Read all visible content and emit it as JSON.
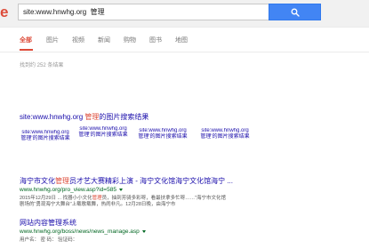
{
  "header": {
    "logo_fragment": "e",
    "query": "site:www.hnwhg.org  管理"
  },
  "tabs": [
    {
      "label": "全部",
      "active": true
    },
    {
      "label": "图片",
      "active": false
    },
    {
      "label": "视频",
      "active": false
    },
    {
      "label": "新闻",
      "active": false
    },
    {
      "label": "购物",
      "active": false
    },
    {
      "label": "图书",
      "active": false
    },
    {
      "label": "地图",
      "active": false
    }
  ],
  "result_stats": "找到约 252 条结果",
  "image_results": {
    "title_prefix": "site:www.hnwhg.org ",
    "title_keyword": "管理",
    "title_suffix": "的图片搜索结果",
    "thumbnails": [
      {
        "line1": "site:www.hnwhg.org",
        "line2": "管理'的图片搜索结果"
      },
      {
        "line1": "site:www.hnwhg.org",
        "line2": "管理'的图片搜索结果"
      },
      {
        "line1": "site:www.hnwhg.org",
        "line2": "管理'的图片搜索结果"
      },
      {
        "line1": "site:www.hnwhg.org",
        "line2": "管理'的图片搜索结果"
      }
    ]
  },
  "results": [
    {
      "title_prefix": "海宁市文化",
      "title_keyword": "管理",
      "title_suffix": "员才艺大赛精彩上演 - 海宁文化馆海宁文化馆海宁 ...",
      "url": "www.hnwhg.org/pro_view.asp?id=585",
      "snippet_line1": "2015年12月29日 ... 找器小小文化",
      "snippet_keyword": "管理",
      "snippet_line1_rest": "员，抽到芳骑多彩呀，看最扶拿多忙呀……”海宁市文化馆",
      "snippet_line2": "剧场的“勇现海宁大舞台”上载歌载舞，热闹非凡。12月28日晚，由海宁市"
    },
    {
      "title_prefix": "网站内容",
      "title_keyword": "管理",
      "title_suffix": "系统",
      "url": "www.hnwhg.org/boss/news/news_manage.asp",
      "snippet_line1": "用户名：   密 码：   验证码：",
      "snippet_keyword": "",
      "snippet_line1_rest": "",
      "snippet_line2": ""
    }
  ]
}
